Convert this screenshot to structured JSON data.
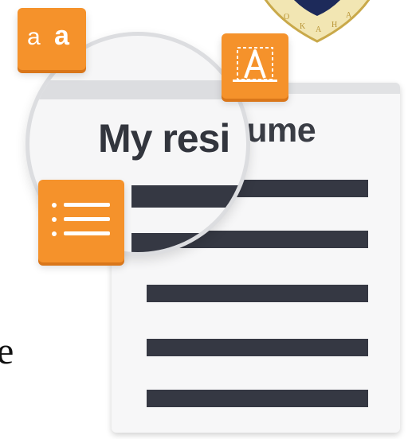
{
  "side_text": {
    "letter": "e"
  },
  "resume": {
    "title": "My resume",
    "magnified_title": "My resi"
  },
  "toolbar": {
    "case_chip": {
      "small": "a",
      "big": "a",
      "icon": "letter-case-icon"
    },
    "font_chip": {
      "icon": "font-style-icon"
    },
    "list_chip": {
      "icon": "bullet-list-icon"
    }
  },
  "colors": {
    "accent": "#f5922b",
    "accent_shadow": "#d9761a",
    "text_lines": "#353843",
    "page": "#f7f7f8"
  }
}
